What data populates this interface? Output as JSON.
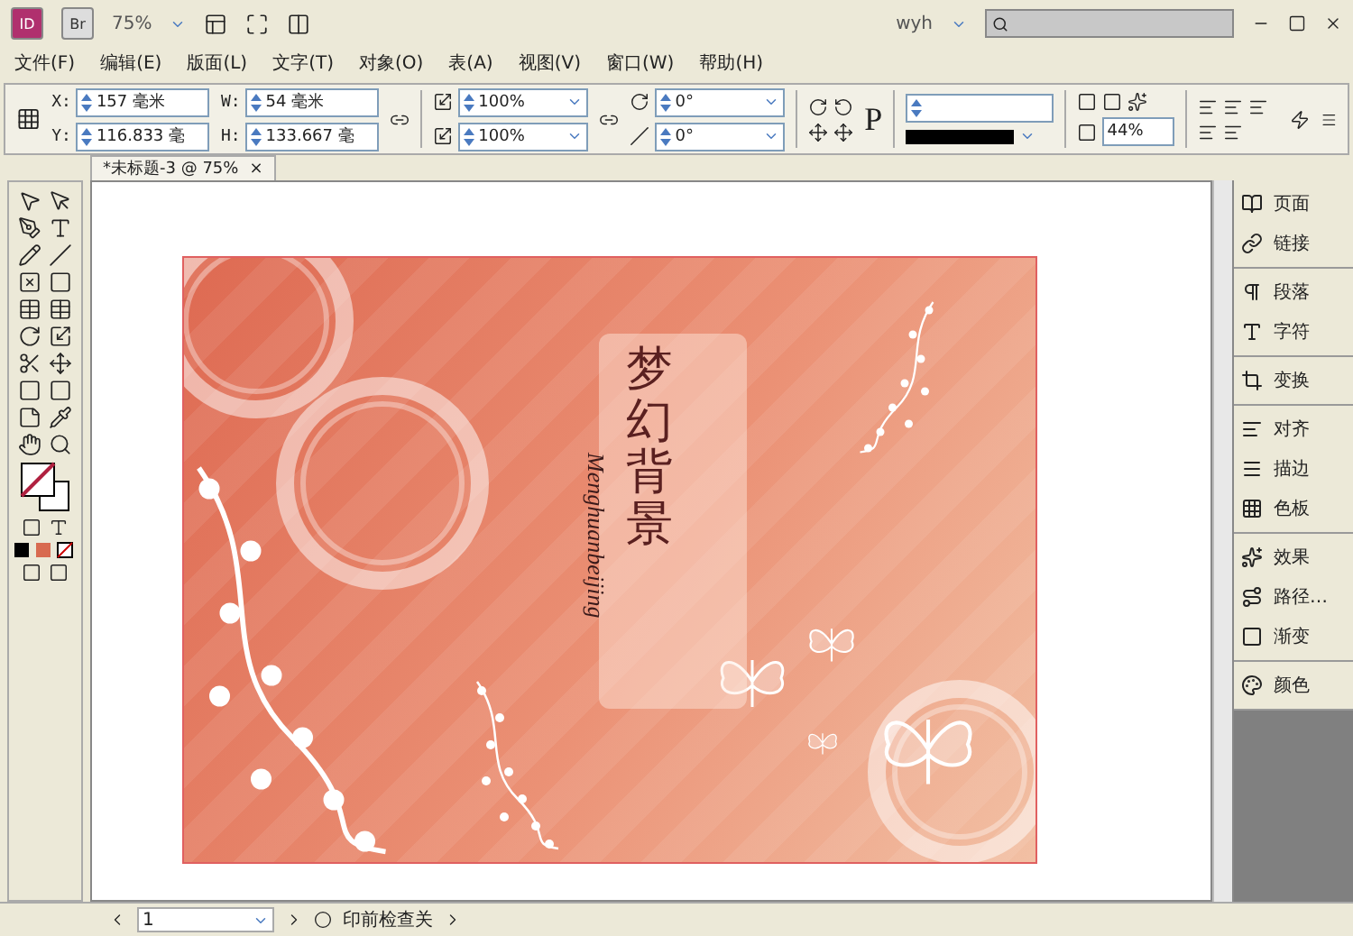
{
  "app_bar": {
    "logo": "ID",
    "bridge": "Br",
    "zoom": "75%",
    "user": "wyh"
  },
  "menu": [
    "文件(F)",
    "编辑(E)",
    "版面(L)",
    "文字(T)",
    "对象(O)",
    "表(A)",
    "视图(V)",
    "窗口(W)",
    "帮助(H)"
  ],
  "control_panel": {
    "fields": [
      {
        "label": "X:",
        "value": "157 毫米"
      },
      {
        "label": "Y:",
        "value": "116.833 毫"
      },
      {
        "label": "W:",
        "value": "54 毫米"
      },
      {
        "label": "H:",
        "value": "133.667 毫"
      }
    ],
    "scale": [
      "100%",
      "100%"
    ],
    "angles": [
      "0°",
      "0°"
    ],
    "frame_letter": "P",
    "opacity": "44%"
  },
  "doc_tab": {
    "title": "*未标题-3 @ 75%",
    "close": "×"
  },
  "artwork": {
    "title": "梦幻背景",
    "subtitle": "Menghuanbeijing"
  },
  "panels": [
    {
      "items": [
        "页面",
        "链接"
      ]
    },
    {
      "items": [
        "段落",
        "字符"
      ]
    },
    {
      "items": [
        "变换"
      ]
    },
    {
      "items": [
        "对齐",
        "描边",
        "色板"
      ]
    },
    {
      "items": [
        "效果",
        "路径…",
        "渐变"
      ]
    },
    {
      "items": [
        "颜色"
      ]
    }
  ],
  "status_bar": {
    "page": "1",
    "preflight": "印前检查关"
  }
}
